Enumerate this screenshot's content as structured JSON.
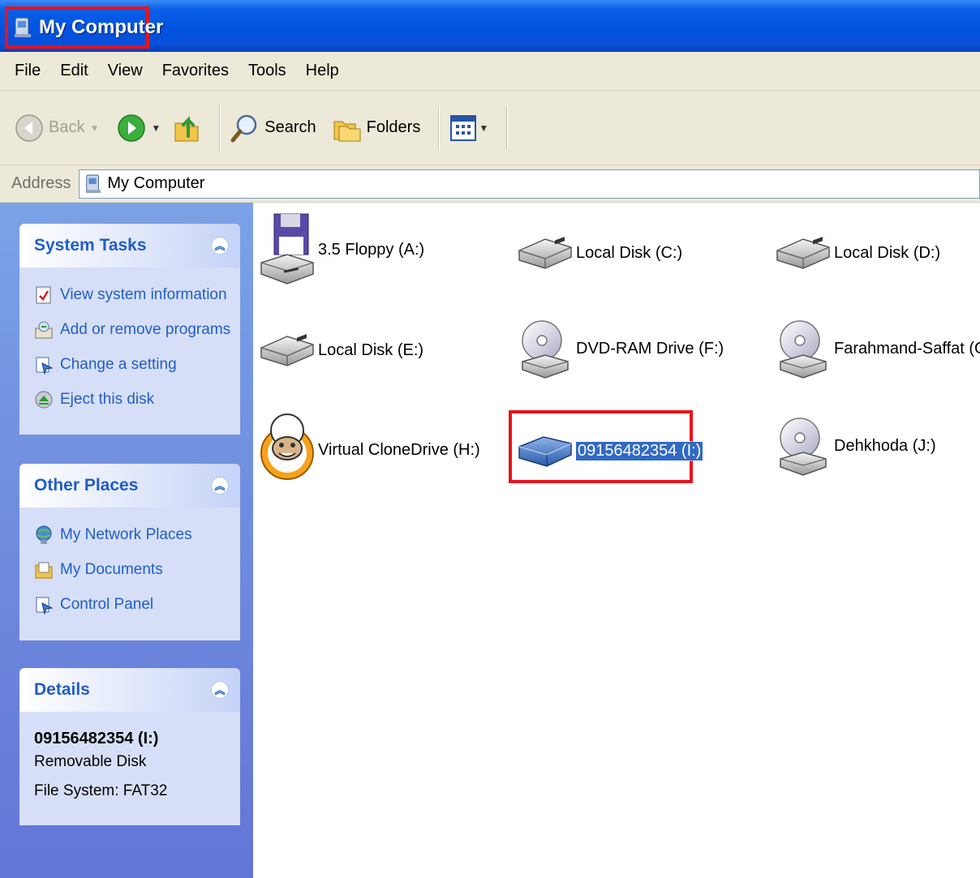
{
  "window": {
    "title": "My Computer"
  },
  "menu": [
    "File",
    "Edit",
    "View",
    "Favorites",
    "Tools",
    "Help"
  ],
  "toolbar": {
    "back_label": "Back",
    "search_label": "Search",
    "folders_label": "Folders"
  },
  "address": {
    "label": "Address",
    "value": "My Computer"
  },
  "panels": {
    "system_tasks": {
      "title": "System Tasks",
      "items": [
        {
          "label": "View system information",
          "icon": "system-info-icon"
        },
        {
          "label": "Add or remove programs",
          "icon": "add-remove-programs-icon"
        },
        {
          "label": "Change a setting",
          "icon": "control-panel-icon"
        },
        {
          "label": "Eject this disk",
          "icon": "eject-icon"
        }
      ]
    },
    "other_places": {
      "title": "Other Places",
      "items": [
        {
          "label": "My Network Places",
          "icon": "network-places-icon"
        },
        {
          "label": "My Documents",
          "icon": "my-documents-icon"
        },
        {
          "label": "Control Panel",
          "icon": "control-panel-icon"
        }
      ]
    },
    "details": {
      "title": "Details",
      "name": "09156482354 (I:)",
      "type": "Removable Disk",
      "filesystem": "File System: FAT32"
    }
  },
  "drives": [
    {
      "label": "3.5 Floppy (A:)",
      "icon": "floppy-drive-icon"
    },
    {
      "label": "Local Disk (C:)",
      "icon": "hard-disk-icon"
    },
    {
      "label": "Local Disk (D:)",
      "icon": "hard-disk-icon"
    },
    {
      "label": "Local Disk (E:)",
      "icon": "hard-disk-icon"
    },
    {
      "label": "DVD-RAM Drive (F:)",
      "icon": "cd-drive-icon"
    },
    {
      "label": "Farahmand-Saffat (G:)",
      "icon": "cd-drive-icon"
    },
    {
      "label": "Virtual CloneDrive (H:)",
      "icon": "virtual-clonedrive-icon"
    },
    {
      "label": "09156482354 (I:)",
      "icon": "removable-disk-icon",
      "selected": true
    },
    {
      "label": "Dehkhoda (J:)",
      "icon": "cd-drive-icon"
    }
  ]
}
